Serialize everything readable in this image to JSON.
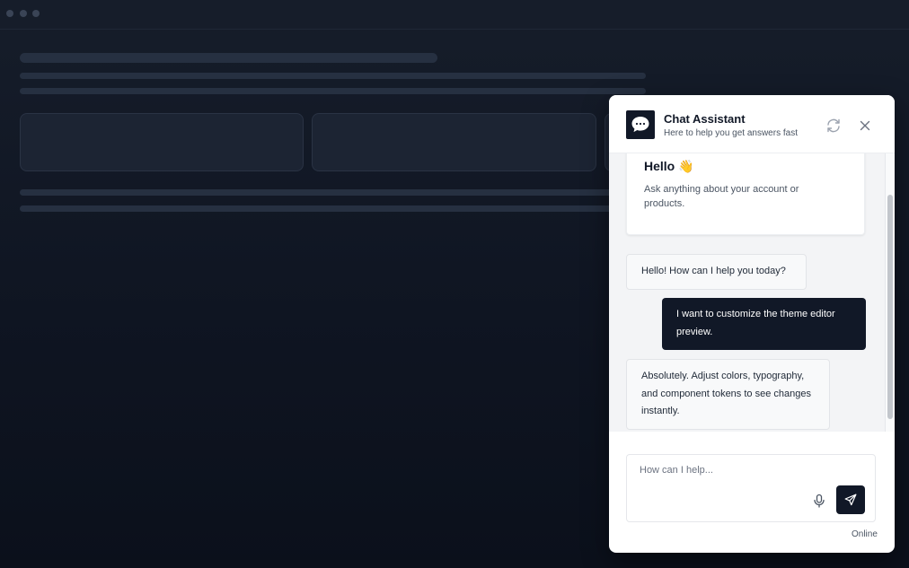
{
  "chat": {
    "title": "Chat Assistant",
    "subtitle": "Here to help you get answers fast",
    "avatar_icon": "chat-bubble-icon",
    "refresh_icon": "refresh-icon",
    "close_icon": "close-icon",
    "welcome": {
      "title": "Hello 👋",
      "text": "Ask anything about your account or products."
    },
    "messages": [
      {
        "role": "bot",
        "text": "Hello! How can I help you today?"
      },
      {
        "role": "user",
        "text": "I want to customize the theme editor preview."
      },
      {
        "role": "bot",
        "text": "Absolutely. Adjust colors, typography, and component tokens to see changes instantly."
      }
    ],
    "input_placeholder": "How can I help...",
    "mic_icon": "microphone-icon",
    "send_icon": "send-icon",
    "status": "Online"
  },
  "colors": {
    "background": "#0f1522",
    "accent": "#111827",
    "panel": "#ffffff"
  }
}
